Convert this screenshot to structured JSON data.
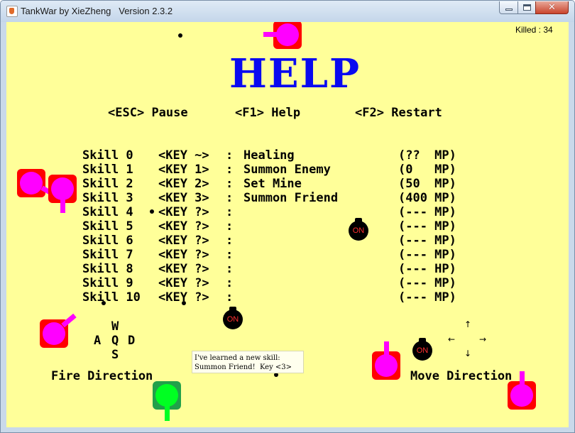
{
  "window": {
    "title": "TankWar by XieZheng   Version 2.3.2",
    "close_glyph": "✕"
  },
  "hud": {
    "killed": "Killed : 34"
  },
  "help": {
    "title": "HELP",
    "hotkeys": [
      {
        "key": "<ESC>",
        "action": "Pause"
      },
      {
        "key": "<F1>",
        "action": "Help"
      },
      {
        "key": "<F2>",
        "action": "Restart"
      }
    ],
    "skills": [
      {
        "name": "Skill 0",
        "key": "<KEY ~>",
        "desc": "Healing",
        "cost": "(??  MP)"
      },
      {
        "name": "Skill 1",
        "key": "<KEY 1>",
        "desc": "Summon Enemy",
        "cost": "(0   MP)"
      },
      {
        "name": "Skill 2",
        "key": "<KEY 2>",
        "desc": "Set Mine",
        "cost": "(50  MP)"
      },
      {
        "name": "Skill 3",
        "key": "<KEY 3>",
        "desc": "Summon Friend",
        "cost": "(400 MP)"
      },
      {
        "name": "Skill 4",
        "key": "<KEY ?>",
        "desc": "",
        "cost": "(--- MP)"
      },
      {
        "name": "Skill 5",
        "key": "<KEY ?>",
        "desc": "",
        "cost": "(--- MP)"
      },
      {
        "name": "Skill 6",
        "key": "<KEY ?>",
        "desc": "",
        "cost": "(--- MP)"
      },
      {
        "name": "Skill 7",
        "key": "<KEY ?>",
        "desc": "",
        "cost": "(--- MP)"
      },
      {
        "name": "Skill 8",
        "key": "<KEY ?>",
        "desc": "",
        "cost": "(--- HP)"
      },
      {
        "name": "Skill 9",
        "key": "<KEY ?>",
        "desc": "",
        "cost": "(--- MP)"
      },
      {
        "name": "Skill 10",
        "key": "<KEY ?>",
        "desc": "",
        "cost": "(--- MP)"
      }
    ],
    "fire_keys": {
      "up": "W",
      "left": "A",
      "center": "Q",
      "right": "D",
      "down": "S"
    },
    "fire_label": "Fire Direction",
    "move_label": "Move Direction",
    "move_arrows": {
      "up": "↑",
      "down": "↓",
      "left": "←",
      "right": "→"
    }
  },
  "mine_label": "ON",
  "notification": {
    "line1": "I've learned a new skill:",
    "line2": "Summon Friend!  Key <3>"
  },
  "colors": {
    "background": "#ffff99",
    "help_title": "#0a0af0",
    "enemy_tank_frame": "#ff0000",
    "enemy_tank_body": "#ff00ff",
    "friend_tank_frame": "#22a04a",
    "friend_tank_body": "#00ff22"
  }
}
